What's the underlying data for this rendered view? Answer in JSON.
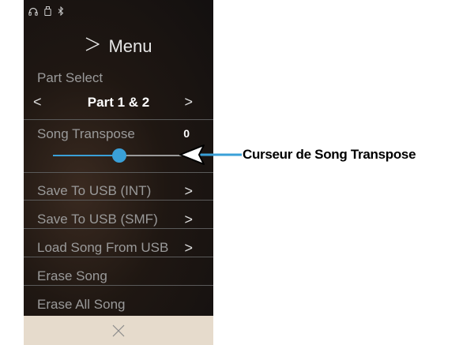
{
  "menu": {
    "title": "Menu",
    "part_select_label": "Part Select",
    "part_value": "Part 1 & 2",
    "transpose": {
      "label": "Song Transpose",
      "value": "0",
      "fill_fraction": 0.5
    },
    "items": [
      {
        "label": "Save To USB (INT)",
        "has_arrow": true
      },
      {
        "label": "Save To USB (SMF)",
        "has_arrow": true
      },
      {
        "label": "Load Song From USB",
        "has_arrow": true
      },
      {
        "label": "Erase Song",
        "has_arrow": false
      },
      {
        "label": "Erase All Song",
        "has_arrow": false
      }
    ]
  },
  "status_icons": [
    "headphones-icon",
    "usb-drive-icon",
    "bluetooth-icon"
  ],
  "annotation": {
    "text": "Curseur de Song Transpose"
  },
  "colors": {
    "accent": "#3aa0d8",
    "close_bar": "#e6dbcc"
  }
}
